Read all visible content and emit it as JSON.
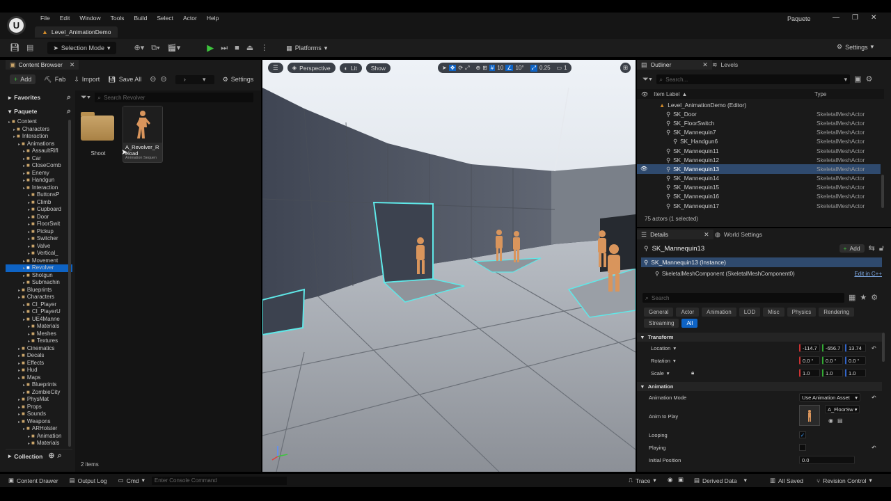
{
  "menubar": {
    "items": [
      "File",
      "Edit",
      "Window",
      "Tools",
      "Build",
      "Select",
      "Actor",
      "Help"
    ],
    "project": "Paquete",
    "level_tab": "Level_AnimationDemo"
  },
  "toolbar": {
    "selection_mode": "Selection Mode",
    "platforms": "Platforms",
    "settings": "Settings"
  },
  "content_browser": {
    "tab": "Content Browser",
    "add": "Add",
    "fab": "Fab",
    "import": "Import",
    "save_all": "Save All",
    "settings": "Settings",
    "favorites": "Favorites",
    "project": "Paquete",
    "search_placeholder": "Search Revolver",
    "collection": "Collection",
    "items_count": "2 items",
    "tree": [
      {
        "label": "Content",
        "d": 0,
        "folder": true
      },
      {
        "label": "Characters",
        "d": 1,
        "folder": true
      },
      {
        "label": "Interaction",
        "d": 1,
        "folder": true
      },
      {
        "label": "Animations",
        "d": 2,
        "folder": true
      },
      {
        "label": "AssaultRifl",
        "d": 3,
        "folder": true
      },
      {
        "label": "Car",
        "d": 3,
        "folder": true
      },
      {
        "label": "CloseComb",
        "d": 3,
        "folder": true
      },
      {
        "label": "Enemy",
        "d": 3,
        "folder": true
      },
      {
        "label": "Handgun",
        "d": 3,
        "folder": true
      },
      {
        "label": "Interaction",
        "d": 3,
        "folder": true
      },
      {
        "label": "ButtonsP",
        "d": 4,
        "folder": true
      },
      {
        "label": "Climb",
        "d": 4,
        "folder": true
      },
      {
        "label": "Cupboard",
        "d": 4,
        "folder": true
      },
      {
        "label": "Door",
        "d": 4,
        "folder": true
      },
      {
        "label": "FloorSwit",
        "d": 4,
        "folder": true
      },
      {
        "label": "Pickup",
        "d": 4,
        "folder": true
      },
      {
        "label": "Switcher",
        "d": 4,
        "folder": true
      },
      {
        "label": "Valve",
        "d": 4,
        "folder": true
      },
      {
        "label": "Vertical_",
        "d": 4,
        "folder": true
      },
      {
        "label": "Movement",
        "d": 3,
        "folder": true
      },
      {
        "label": "Revolver",
        "d": 3,
        "folder": true,
        "selected": true
      },
      {
        "label": "Shotgun",
        "d": 3,
        "folder": true
      },
      {
        "label": "Submachin",
        "d": 3,
        "folder": true
      },
      {
        "label": "Blueprints",
        "d": 2,
        "folder": true
      },
      {
        "label": "Characters",
        "d": 2,
        "folder": true
      },
      {
        "label": "CI_Player",
        "d": 3,
        "folder": true
      },
      {
        "label": "CI_PlayerU",
        "d": 3,
        "folder": true
      },
      {
        "label": "UE4Manne",
        "d": 3,
        "folder": true
      },
      {
        "label": "Materials",
        "d": 4,
        "folder": true
      },
      {
        "label": "Meshes",
        "d": 4,
        "folder": true
      },
      {
        "label": "Textures",
        "d": 4,
        "folder": true
      },
      {
        "label": "Cinematics",
        "d": 2,
        "folder": true
      },
      {
        "label": "Decals",
        "d": 2,
        "folder": true
      },
      {
        "label": "Effects",
        "d": 2,
        "folder": true
      },
      {
        "label": "Hud",
        "d": 2,
        "folder": true
      },
      {
        "label": "Maps",
        "d": 2,
        "folder": true
      },
      {
        "label": "Blueprints",
        "d": 3,
        "folder": true
      },
      {
        "label": "ZombieCity",
        "d": 3,
        "folder": true
      },
      {
        "label": "PhysMat",
        "d": 2,
        "folder": true
      },
      {
        "label": "Props",
        "d": 2,
        "folder": true
      },
      {
        "label": "Sounds",
        "d": 2,
        "folder": true
      },
      {
        "label": "Weapons",
        "d": 2,
        "folder": true
      },
      {
        "label": "ARHolster",
        "d": 3,
        "folder": true
      },
      {
        "label": "Animation",
        "d": 4,
        "folder": true
      },
      {
        "label": "Materials",
        "d": 4,
        "folder": true
      }
    ],
    "assets": [
      {
        "name": "Shoot",
        "type": "folder"
      },
      {
        "name": "A_Revolver_Reload",
        "type": "Animation Sequence",
        "type_label": "Animation Sequen"
      }
    ]
  },
  "viewport": {
    "perspective": "Perspective",
    "lit": "Lit",
    "show": "Show",
    "grid": "10",
    "angle": "10°",
    "scale": "0.25",
    "camera": "1"
  },
  "outliner": {
    "tab": "Outliner",
    "levels_tab": "Levels",
    "search_placeholder": "Search...",
    "col_label": "Item Label",
    "col_type": "Type",
    "rows": [
      {
        "label": "Level_AnimationDemo (Editor)",
        "type": "",
        "indent": 0
      },
      {
        "label": "SK_Door",
        "type": "SkeletalMeshActor",
        "indent": 1
      },
      {
        "label": "SK_FloorSwitch",
        "type": "SkeletalMeshActor",
        "indent": 1
      },
      {
        "label": "SK_Mannequin7",
        "type": "SkeletalMeshActor",
        "indent": 1
      },
      {
        "label": "SK_Handgun6",
        "type": "SkeletalMeshActor",
        "indent": 2
      },
      {
        "label": "SK_Mannequin11",
        "type": "SkeletalMeshActor",
        "indent": 1
      },
      {
        "label": "SK_Mannequin12",
        "type": "SkeletalMeshActor",
        "indent": 1
      },
      {
        "label": "SK_Mannequin13",
        "type": "SkeletalMeshActor",
        "indent": 1,
        "selected": true
      },
      {
        "label": "SK_Mannequin14",
        "type": "SkeletalMeshActor",
        "indent": 1
      },
      {
        "label": "SK_Mannequin15",
        "type": "SkeletalMeshActor",
        "indent": 1
      },
      {
        "label": "SK_Mannequin16",
        "type": "SkeletalMeshActor",
        "indent": 1
      },
      {
        "label": "SK_Mannequin17",
        "type": "SkeletalMeshActor",
        "indent": 1
      }
    ],
    "status": "75 actors (1 selected)"
  },
  "details": {
    "tab": "Details",
    "world_tab": "World Settings",
    "object": "SK_Mannequin13",
    "add": "Add",
    "instance": "SK_Mannequin13 (Instance)",
    "component": "SkeletalMeshComponent (SkeletalMeshComponent0)",
    "edit_cpp": "Edit in C++",
    "search_placeholder": "Search",
    "filters": [
      "General",
      "Actor",
      "Animation",
      "LOD",
      "Misc",
      "Physics",
      "Rendering"
    ],
    "filters2": [
      "Streaming",
      "All"
    ],
    "transform_header": "Transform",
    "location_label": "Location",
    "location": [
      "-114.7",
      "-656.7",
      "13.74´"
    ],
    "rotation_label": "Rotation",
    "rotation": [
      "0.0 °",
      "0.0 °",
      "0.0 °"
    ],
    "scale_label": "Scale",
    "scale": [
      "1.0",
      "1.0",
      "1.0"
    ],
    "animation_header": "Animation",
    "anim_mode_label": "Animation Mode",
    "anim_mode": "Use Animation Asset",
    "anim_play_label": "Anim to Play",
    "anim_play": "A_FloorSw",
    "looping_label": "Looping",
    "playing_label": "Playing",
    "initial_pos_label": "Initial Position",
    "initial_pos": "0.0"
  },
  "statusbar": {
    "content_drawer": "Content Drawer",
    "output_log": "Output Log",
    "cmd": "Cmd",
    "console_placeholder": "Enter Console Command",
    "trace": "Trace",
    "derived_data": "Derived Data",
    "all_saved": "All Saved",
    "revision_control": "Revision Control"
  },
  "colors": {
    "accent": "#0e63c4",
    "selected_row": "#2f4a6e",
    "play_green": "#3dc43d"
  }
}
